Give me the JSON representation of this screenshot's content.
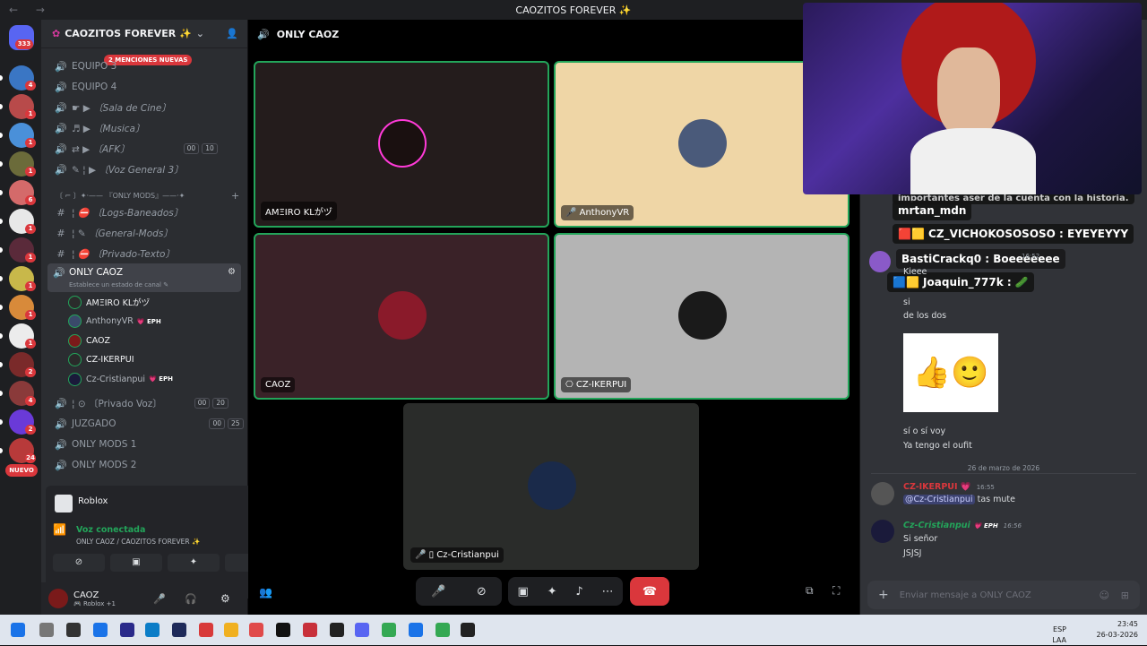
{
  "window": {
    "title": "CAOZITOS FOREVER ✨",
    "nav": "← →"
  },
  "guilds": {
    "home_badge": "333",
    "items": [
      {
        "color": "#3a76c4",
        "badge": "4"
      },
      {
        "color": "#b84a4a",
        "badge": "1"
      },
      {
        "color": "#4a90d9",
        "badge": "1"
      },
      {
        "color": "#6b6b3a",
        "badge": "1"
      },
      {
        "color": "#d46a6a",
        "badge": "6"
      },
      {
        "color": "#e8e8e8",
        "badge": "1"
      },
      {
        "color": "#5a2a3a",
        "badge": "1"
      },
      {
        "color": "#c8b84a",
        "badge": "1"
      },
      {
        "color": "#d88a3a",
        "badge": "1"
      },
      {
        "color": "#ececec",
        "badge": "1"
      },
      {
        "color": "#7a2a2a",
        "badge": "2"
      },
      {
        "color": "#8a3a3a",
        "badge": "4"
      },
      {
        "color": "#6a3ad8",
        "badge": "2"
      },
      {
        "color": "#b83a3a",
        "badge": "24"
      }
    ],
    "new_label": "NUEVO"
  },
  "server": {
    "name": "CAOZITOS FOREVER ✨"
  },
  "channels": {
    "mentions_label": "2 MENCIONES NUEVAS",
    "list": [
      {
        "name": "EQUIPO 3",
        "icon": "🔊"
      },
      {
        "name": "EQUIPO 4",
        "icon": "🔊"
      },
      {
        "name": "☛ ▶ 〔Sala de Cine〕",
        "icon": "🔊"
      },
      {
        "name": "♬ ▶ 〔Musica〕",
        "icon": "🔊"
      },
      {
        "name": "⇄ ▶ 〔AFK〕",
        "icon": "🔊",
        "pill1": "00",
        "pill2": "10"
      },
      {
        "name": "✎ ¦ ▶ 〔Voz General 3〕",
        "icon": "🔊"
      }
    ],
    "category": "〔 ⌐ 〕✦·—— 『ONLY MODS』——·✦",
    "text_channels": [
      {
        "name": "¦ ⛔ 〔Logs-Baneados〕",
        "icon": "#"
      },
      {
        "name": "¦ ✎ 〔General-Mods〕",
        "icon": "#"
      },
      {
        "name": "¦ ⛔ 〔Privado-Texto〕",
        "icon": "#"
      }
    ],
    "active_voice": {
      "name": "ONLY CAOZ",
      "status": "Establece un estado de canal ✎"
    },
    "members": [
      {
        "name": "AMΞIRO KLがヅ",
        "color": "#2b2b2b"
      },
      {
        "name": "AnthonyVR",
        "color": "#3a4a6a",
        "eph": "💗 EPH"
      },
      {
        "name": "CAOZ",
        "color": "#7a1a1a"
      },
      {
        "name": "CZ-IKERPUI",
        "color": "#2a2a2a"
      },
      {
        "name": "Cz-Cristianpui",
        "color": "#1a1a3a",
        "eph": "💗 EPH"
      }
    ],
    "more": [
      {
        "name": "¦ ⊙ 〔Privado Voz〕",
        "icon": "🔊",
        "pill1": "00",
        "pill2": "20"
      },
      {
        "name": "JUZGADO",
        "icon": "🔊",
        "pill1": "00",
        "pill2": "25"
      },
      {
        "name": "ONLY MODS 1",
        "icon": "🔊"
      },
      {
        "name": "ONLY MODS 2",
        "icon": "🔊"
      }
    ]
  },
  "activity": {
    "game": "Roblox",
    "voice_status": "Voz conectada",
    "voice_location": "ONLY CAOZ / CAOZITOS FOREVER ✨"
  },
  "user": {
    "name": "CAOZ",
    "status": "🎮 Roblox +1"
  },
  "call": {
    "channel_title": "ONLY CAOZ",
    "tiles": [
      {
        "name": "AMΞIRO KLがヅ",
        "bg": "#241c1c"
      },
      {
        "name": "🎤 AnthonyVR",
        "bg": "#efd6a6"
      },
      {
        "name": "CAOZ",
        "bg": "#3a2228"
      },
      {
        "name": "⎔ CZ-IKERPUI",
        "bg": "#b4b4b4"
      },
      {
        "name": "🎤 ▯ Cz-Cristianpui",
        "bg": "#2a2c2a"
      }
    ]
  },
  "chat": {
    "overlay": [
      "importantes aser de la cuenta con la historia.",
      "mrtan_mdn",
      "🟥🟨 CZ_VICHOKOSOSOSO : EYEYEYYY",
      "BastiCrackq0 : Boeeeeeee",
      "🟦🟨 Joaquin_777k : 🥒"
    ],
    "messages_top": [
      "Kieee",
      "si",
      "de los dos"
    ],
    "sticker": "👍🙂",
    "messages_mid": [
      "sí o sí voy",
      "Ya tengo el oufit"
    ],
    "date_divider": "26 de marzo de 2026",
    "m1_user": "CZ-IKERPUI 💗",
    "m1_time": "16:55",
    "m1_text_mention": "@Cz-Cristianpui",
    "m1_text": "tas mute",
    "m2_user": "Cz-Cristianpui",
    "m2_tag": "💗 EPH",
    "m2_time": "16:56",
    "m2_lines": [
      "Si señor",
      "JSJSJ"
    ],
    "time_faded": "16:52",
    "input_placeholder": "Enviar mensaje a ONLY CAOZ"
  },
  "taskbar": {
    "lang": "ESP",
    "lang2": "LAA",
    "time": "23:45",
    "date": "26-03-2026"
  }
}
